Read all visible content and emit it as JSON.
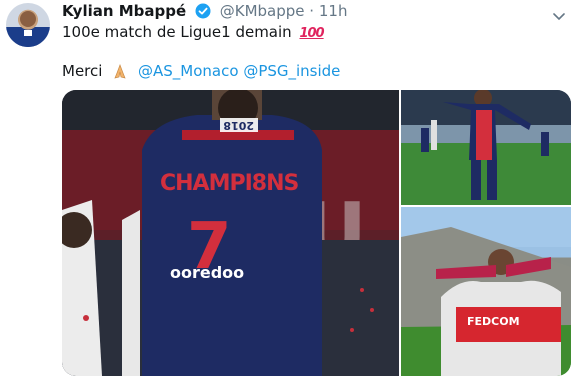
{
  "tweet": {
    "author_name": "Kylian Mbappé",
    "handle": "@KMbappe",
    "separator": "·",
    "time": "11h",
    "line1": "100e match de Ligue1 demain",
    "emoji_100": "100",
    "line2_prefix": "Merci",
    "mention1": "@AS_Monaco",
    "mention2": "@PSG_inside"
  },
  "media": {
    "main_photo": {
      "shirt_name": "CHAMPI8NS",
      "shirt_number": "7",
      "sponsor": "ooredoo",
      "collar_text": "2018"
    },
    "bottom_right_photo": {
      "shirt_sponsor": "FEDCOM"
    }
  },
  "colors": {
    "link": "#1b95e0",
    "verified": "#1da1f2",
    "muted": "#657786"
  }
}
